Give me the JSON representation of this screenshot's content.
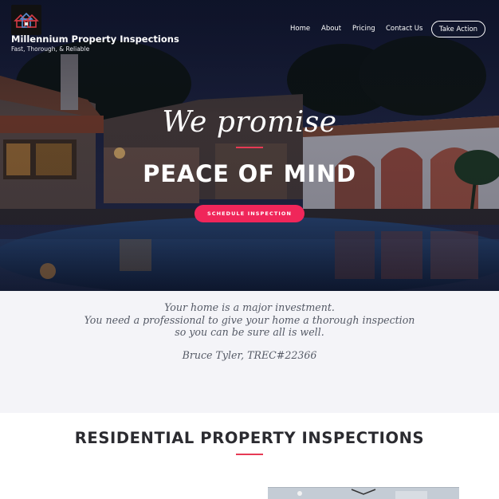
{
  "header": {
    "brand_name": "Millennium Property Inspections",
    "tagline": "Fast, Thorough, & Reliable",
    "nav": [
      "Home",
      "About",
      "Pricing",
      "Contact Us"
    ],
    "cta_label": "Take Action"
  },
  "hero": {
    "headline_script": "We promise",
    "headline_main": "PEACE OF MIND",
    "button_label": "SCHEDULE INSPECTION"
  },
  "quote": {
    "lines": [
      "Your home is a major investment.",
      "You need a professional to give your home a thorough inspection",
      "so you can be sure all is well."
    ],
    "signature": "Bruce Tyler, TREC#22366"
  },
  "residential": {
    "title": "RESIDENTIAL PROPERTY INSPECTIONS"
  },
  "colors": {
    "accent": "#f0265a",
    "rule": "#e63a55",
    "quote_bg": "#f4f4f8",
    "quote_text": "#555a66",
    "title_text": "#2b2b30"
  },
  "icons": {
    "logo": "house-logo-icon"
  }
}
